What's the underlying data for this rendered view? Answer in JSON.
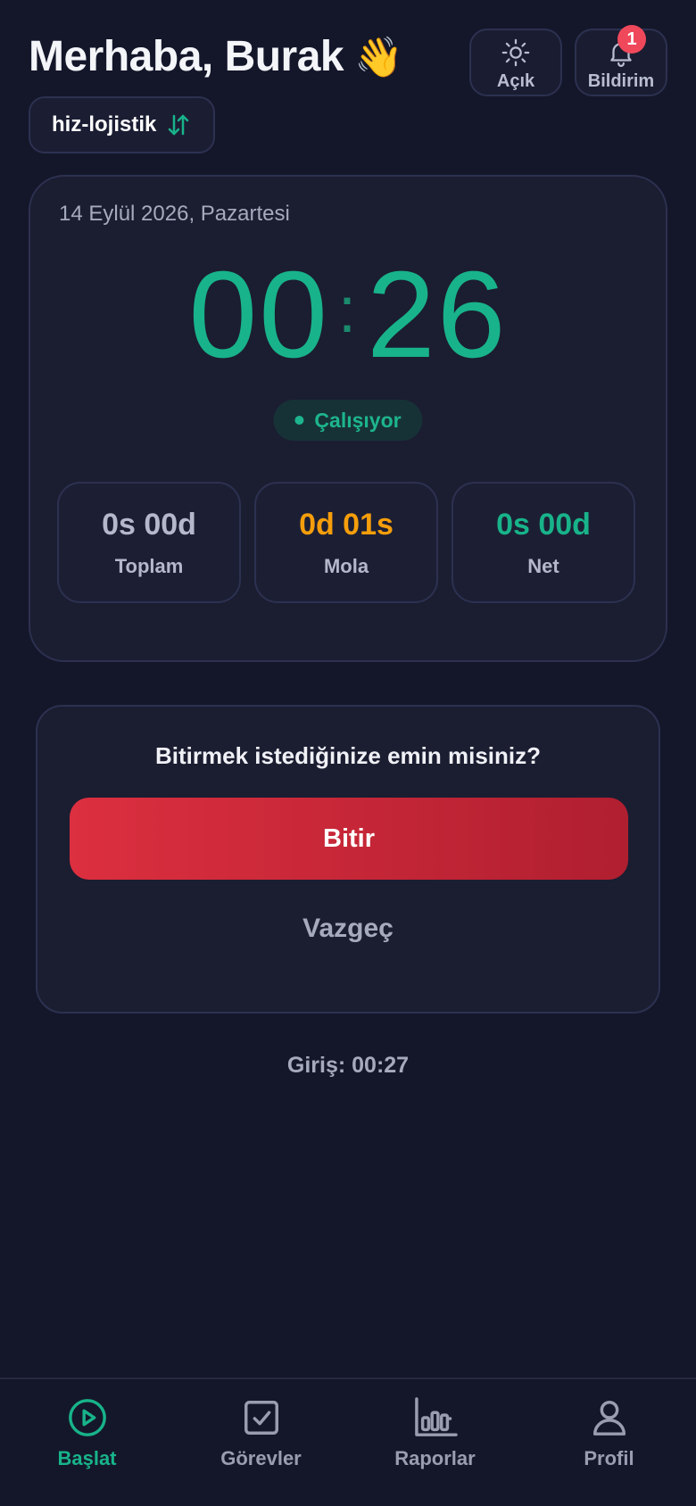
{
  "header": {
    "greeting": "Merhaba, Burak",
    "wave_emoji": "👋",
    "theme_button": {
      "label": "Açık",
      "icon": "sun-icon"
    },
    "notification_button": {
      "label": "Bildirim",
      "icon": "bell-icon",
      "badge_count": "1"
    }
  },
  "organization": {
    "name": "hiz-lojistik",
    "icon": "swap-vertical-icon"
  },
  "timer_card": {
    "date": "14 Eylül 2026, Pazartesi",
    "hours": "00",
    "minutes": "26",
    "separator": ":",
    "status": "Çalışıyor",
    "stats": [
      {
        "value": "0s 00d",
        "label": "Toplam",
        "color": "#b4b8ca"
      },
      {
        "value": "0d 01s",
        "label": "Mola",
        "color": "#f59e0b"
      },
      {
        "value": "0s 00d",
        "label": "Net",
        "color": "#18b38a"
      }
    ]
  },
  "confirm_dialog": {
    "question": "Bitirmek istediğinize emin misiniz?",
    "confirm_label": "Bitir",
    "cancel_label": "Vazgeç"
  },
  "login_info": "Giriş: 00:27",
  "bottom_nav": [
    {
      "label": "Başlat",
      "icon": "play-circle-icon",
      "active": true
    },
    {
      "label": "Görevler",
      "icon": "checkbox-icon",
      "active": false
    },
    {
      "label": "Raporlar",
      "icon": "bar-chart-icon",
      "active": false
    },
    {
      "label": "Profil",
      "icon": "user-icon",
      "active": false
    }
  ],
  "colors": {
    "background": "#14172a",
    "accent": "#18b38a",
    "danger": "#dc2f3f",
    "break": "#f59e0b"
  }
}
